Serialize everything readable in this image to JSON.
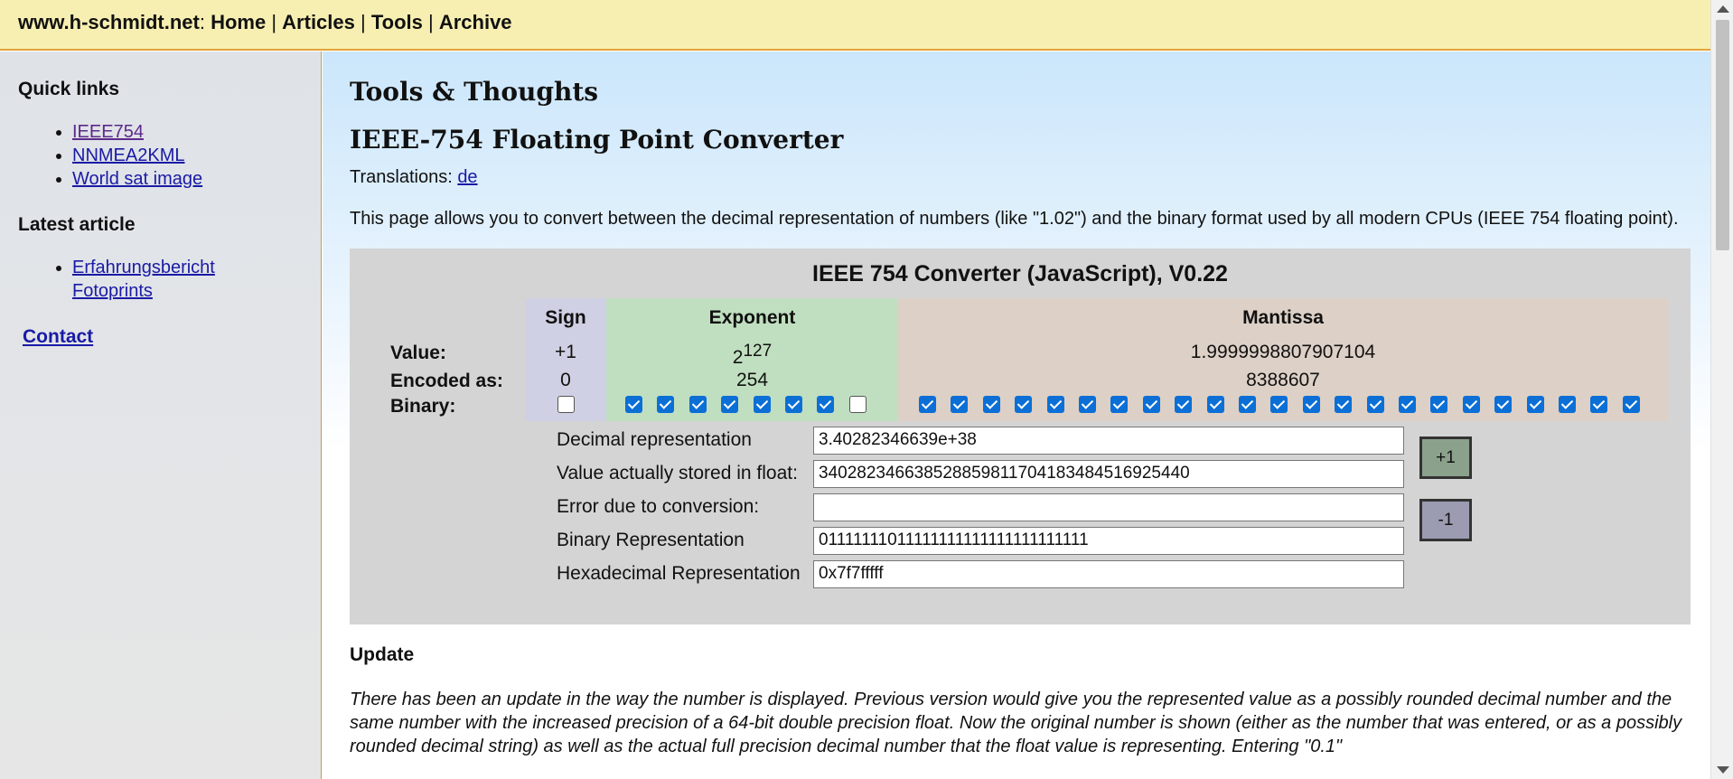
{
  "topbar": {
    "site": "www.h-schmidt.net",
    "nav": [
      "Home",
      "Articles",
      "Tools",
      "Archive"
    ]
  },
  "sidebar": {
    "quick_links_title": "Quick links",
    "quick_links": [
      "IEEE754",
      "NNMEA2KML",
      "World sat image"
    ],
    "latest_title": "Latest article",
    "latest_line1": "Erfahrungsbericht",
    "latest_line2": "Fotoprints",
    "contact": "Contact"
  },
  "main": {
    "section_title": "Tools & Thoughts",
    "page_title": "IEEE-754 Floating Point Converter",
    "translations_label": "Translations:",
    "translations_link": "de",
    "intro": "This page allows you to convert between the decimal representation of numbers (like \"1.02\") and the binary format used by all modern CPUs (IEEE 754 floating point).",
    "update_title": "Update",
    "update_text": "There has been an update in the way the number is displayed. Previous version would give you the represented value as a possibly rounded decimal number and the same number with the increased precision of a 64-bit double precision float. Now the original number is shown (either as the number that was entered, or as a possibly rounded decimal string) as well as the actual full precision decimal number that the float value is representing. Entering \"0.1\""
  },
  "converter": {
    "title": "IEEE 754 Converter (JavaScript), V0.22",
    "headers": {
      "sign": "Sign",
      "exponent": "Exponent",
      "mantissa": "Mantissa"
    },
    "row_labels": {
      "value": "Value:",
      "encoded": "Encoded as:",
      "binary": "Binary:"
    },
    "sign": {
      "value": "+1",
      "encoded": "0",
      "bits": [
        0
      ]
    },
    "exponent": {
      "value_base": "2",
      "value_power": "127",
      "encoded": "254",
      "bits": [
        1,
        1,
        1,
        1,
        1,
        1,
        1,
        0
      ]
    },
    "mantissa": {
      "value": "1.9999998807907104",
      "encoded": "8388607",
      "bits": [
        1,
        1,
        1,
        1,
        1,
        1,
        1,
        1,
        1,
        1,
        1,
        1,
        1,
        1,
        1,
        1,
        1,
        1,
        1,
        1,
        1,
        1,
        1
      ]
    },
    "fields": [
      {
        "label": "Decimal representation",
        "value": "3.40282346639e+38"
      },
      {
        "label": "Value actually stored in float:",
        "value": "340282346638528859811704183484516925440"
      },
      {
        "label": "Error due to conversion:",
        "value": ""
      },
      {
        "label": "Binary Representation",
        "value": "01111111011111111111111111111111"
      },
      {
        "label": "Hexadecimal Representation",
        "value": "0x7f7fffff"
      }
    ],
    "plus_button": "+1",
    "minus_button": "-1"
  }
}
